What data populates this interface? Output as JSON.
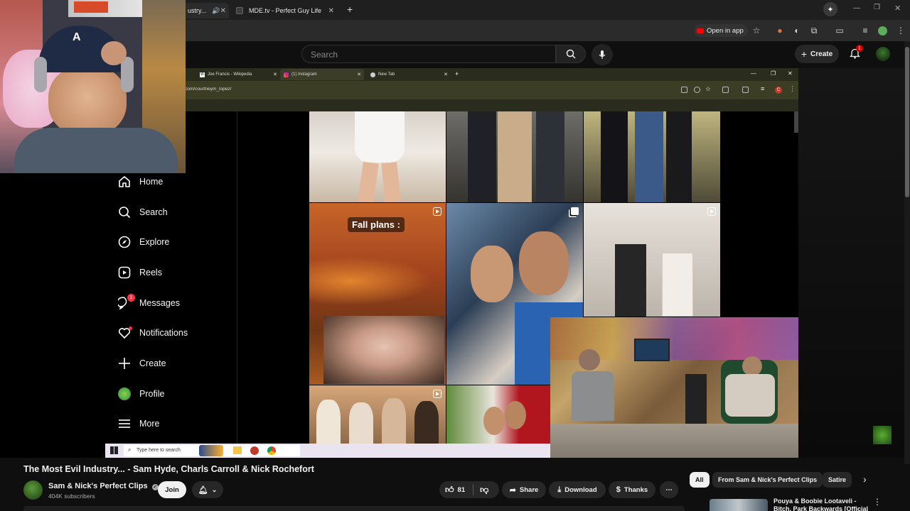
{
  "browser": {
    "tabs": [
      {
        "label": "ustry...",
        "active": true,
        "has_audio": true
      },
      {
        "label": "MDE.tv - Perfect Guy Life",
        "active": false
      }
    ],
    "open_in_app_label": "Open in app"
  },
  "youtube": {
    "search_placeholder": "Search",
    "create_label": "Create",
    "notification_count": "1"
  },
  "inner_browser": {
    "tabs": [
      {
        "label": "Joe Francis - Wikipedia"
      },
      {
        "label": "(1) Instagram",
        "active": true
      },
      {
        "label": "New Tab"
      }
    ],
    "url": "com/courtneym_lopez/"
  },
  "instagram": {
    "nav": [
      {
        "label": "Home",
        "icon": "home-icon"
      },
      {
        "label": "Search",
        "icon": "search-icon"
      },
      {
        "label": "Explore",
        "icon": "compass-icon"
      },
      {
        "label": "Reels",
        "icon": "reels-icon"
      },
      {
        "label": "Messages",
        "icon": "messenger-icon",
        "badge": "1"
      },
      {
        "label": "Notifications",
        "icon": "heart-icon",
        "dot": true
      },
      {
        "label": "Create",
        "icon": "plus-icon"
      },
      {
        "label": "Profile",
        "icon": "avatar-icon"
      },
      {
        "label": "More",
        "icon": "hamburger-icon"
      }
    ],
    "post_overlay_text": "Fall plans :"
  },
  "taskbar": {
    "search_placeholder": "Type here to search"
  },
  "video": {
    "title": "The Most Evil Industry... - Sam Hyde, Charls Carroll & Nick Rochefort",
    "channel": "Sam & Nick's Perfect Clips",
    "subscribers": "404K subscribers",
    "join_label": "Join",
    "likes": "81",
    "share_label": "Share",
    "download_label": "Download",
    "thanks_label": "Thanks"
  },
  "recommendations": {
    "chips": [
      "All",
      "From Sam & Nick's Perfect Clips",
      "Satire"
    ],
    "first_title": "Pouya & Boobie Lootaveli - Bitch, Park Backwards [Official"
  },
  "colors": {
    "youtube_red": "#ff0000",
    "instagram_badge": "#ff3040",
    "background": "#0f0f0f"
  }
}
